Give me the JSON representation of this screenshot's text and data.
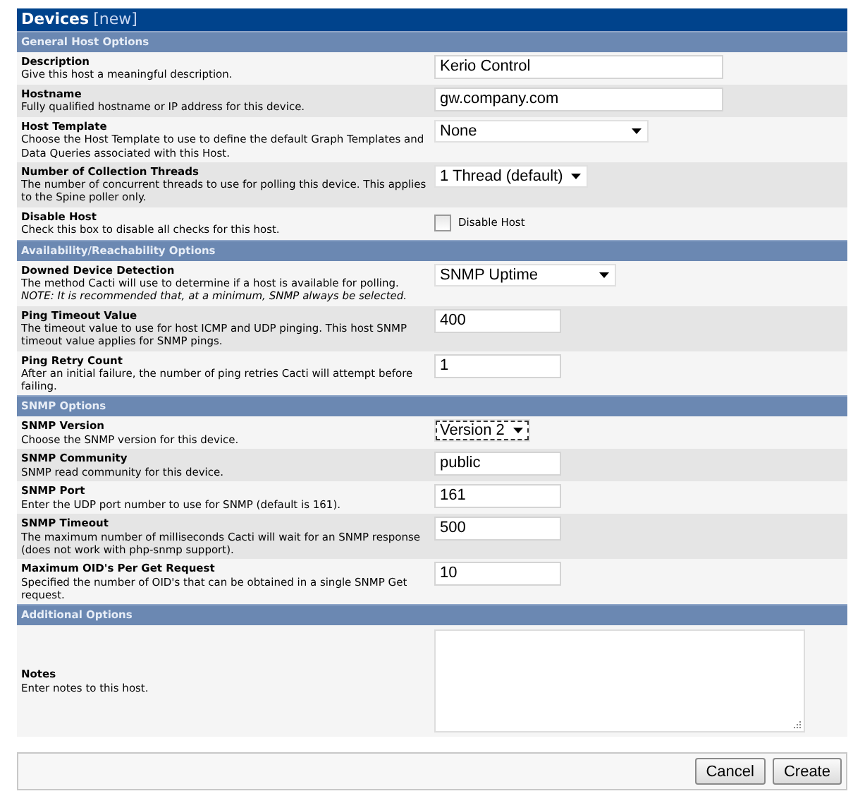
{
  "header": {
    "title": "Devices",
    "badge": "[new]"
  },
  "sections": [
    {
      "title": "General Host Options",
      "rows": [
        {
          "label": "Description",
          "description": "Give this host a meaningful description.",
          "field": {
            "kind": "text",
            "value": "Kerio Control"
          }
        },
        {
          "label": "Hostname",
          "description": "Fully qualified hostname or IP address for this device.",
          "field": {
            "kind": "text",
            "value": "gw.company.com"
          }
        },
        {
          "label": "Host Template",
          "description": "Choose the Host Template to use to define the default Graph Templates and Data Queries associated with this Host.",
          "field": {
            "kind": "select",
            "value": "None"
          }
        },
        {
          "label": "Number of Collection Threads",
          "description": "The number of concurrent threads to use for polling this device. This applies to the Spine poller only.",
          "field": {
            "kind": "select",
            "value": "1 Thread (default)"
          }
        },
        {
          "label": "Disable Host",
          "description": "Check this box to disable all checks for this host.",
          "field": {
            "kind": "checkbox",
            "checked": false,
            "value": "Disable Host"
          }
        }
      ]
    },
    {
      "title": "Availability/Reachability Options",
      "rows": [
        {
          "label": "Downed Device Detection",
          "description": "The method Cacti will use to determine if a host is available for polling.",
          "note": "NOTE: It is recommended that, at a minimum, SNMP always be selected.",
          "field": {
            "kind": "select",
            "value": "SNMP Uptime"
          }
        },
        {
          "label": "Ping Timeout Value",
          "description": "The timeout value to use for host ICMP and UDP pinging. This host SNMP timeout value applies for SNMP pings.",
          "field": {
            "kind": "text",
            "value": "400"
          }
        },
        {
          "label": "Ping Retry Count",
          "description": "After an initial failure, the number of ping retries Cacti will attempt before failing.",
          "field": {
            "kind": "text",
            "value": "1"
          }
        }
      ]
    },
    {
      "title": "SNMP Options",
      "rows": [
        {
          "label": "SNMP Version",
          "description": "Choose the SNMP version for this device.",
          "field": {
            "kind": "select",
            "value": "Version 2",
            "focused": true
          }
        },
        {
          "label": "SNMP Community",
          "description": "SNMP read community for this device.",
          "field": {
            "kind": "text",
            "value": "public"
          }
        },
        {
          "label": "SNMP Port",
          "description": "Enter the UDP port number to use for SNMP (default is 161).",
          "field": {
            "kind": "text",
            "value": "161"
          }
        },
        {
          "label": "SNMP Timeout",
          "description": "The maximum number of milliseconds Cacti will wait for an SNMP response (does not work with php-snmp support).",
          "field": {
            "kind": "text",
            "value": "500"
          }
        },
        {
          "label": "Maximum OID's Per Get Request",
          "description": "Specified the number of OID's that can be obtained in a single SNMP Get request.",
          "field": {
            "kind": "text",
            "value": "10"
          }
        }
      ]
    },
    {
      "title": "Additional Options",
      "rows": [
        {
          "label": "Notes",
          "description": "Enter notes to this host.",
          "field": {
            "kind": "textarea"
          }
        }
      ]
    }
  ],
  "buttons": [
    "Cancel",
    "Create"
  ]
}
